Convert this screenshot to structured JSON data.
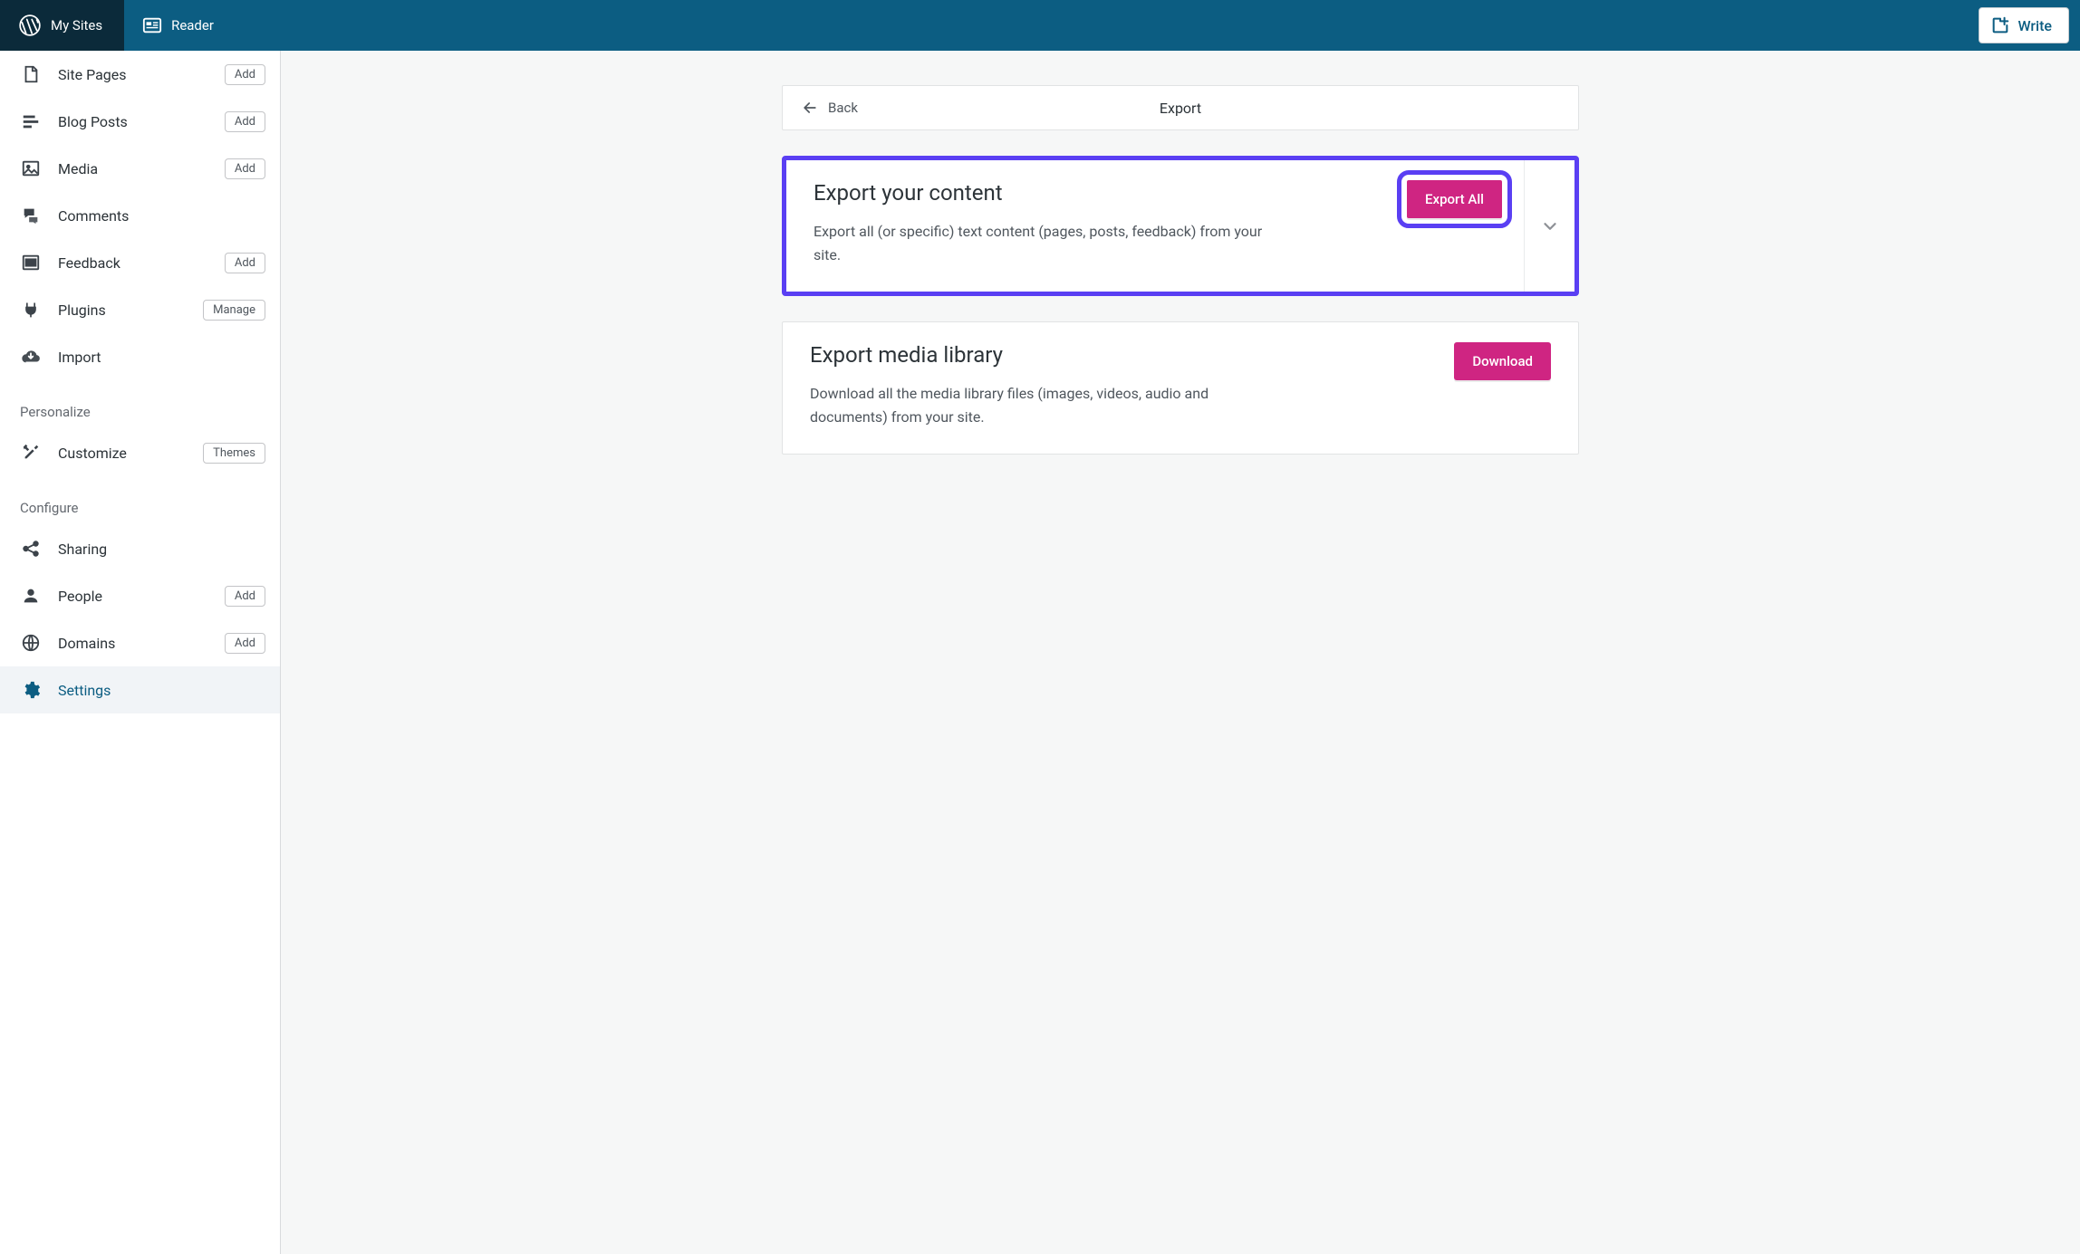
{
  "topbar": {
    "mysites": "My Sites",
    "reader": "Reader",
    "write": "Write"
  },
  "sidebar": {
    "items": [
      {
        "label": "Site Pages",
        "pill": "Add"
      },
      {
        "label": "Blog Posts",
        "pill": "Add"
      },
      {
        "label": "Media",
        "pill": "Add"
      },
      {
        "label": "Comments"
      },
      {
        "label": "Feedback",
        "pill": "Add"
      },
      {
        "label": "Plugins",
        "pill": "Manage"
      },
      {
        "label": "Import"
      }
    ],
    "personalize_head": "Personalize",
    "personalize": [
      {
        "label": "Customize",
        "pill": "Themes"
      }
    ],
    "configure_head": "Configure",
    "configure": [
      {
        "label": "Sharing"
      },
      {
        "label": "People",
        "pill": "Add"
      },
      {
        "label": "Domains",
        "pill": "Add"
      },
      {
        "label": "Settings"
      }
    ]
  },
  "header": {
    "back": "Back",
    "title": "Export"
  },
  "card1": {
    "title": "Export your content",
    "desc": "Export all (or specific) text content (pages, posts, feedback) from your site.",
    "button": "Export All"
  },
  "card2": {
    "title": "Export media library",
    "desc": "Download all the media library files (images, videos, audio and documents) from your site.",
    "button": "Download"
  }
}
